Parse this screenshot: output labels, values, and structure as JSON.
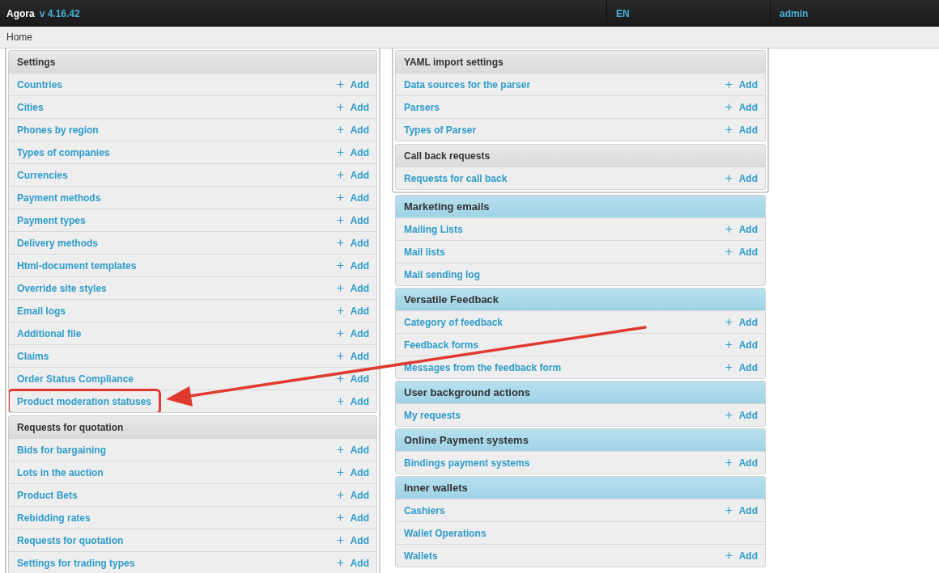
{
  "top_bar": {
    "brand": "Agora",
    "version": "v 4.16.42",
    "language": "EN",
    "user": "admin"
  },
  "breadcrumb": "Home",
  "columns": [
    {
      "blocks": [
        {
          "kind": "framed",
          "sections": [
            {
              "title": "Settings",
              "rows": [
                {
                  "label": "Countries",
                  "action": "Add",
                  "highlighted": false
                },
                {
                  "label": "Cities",
                  "action": "Add",
                  "highlighted": false
                },
                {
                  "label": "Phones by region",
                  "action": "Add",
                  "highlighted": false
                },
                {
                  "label": "Types of companies",
                  "action": "Add",
                  "highlighted": false
                },
                {
                  "label": "Currencies",
                  "action": "Add",
                  "highlighted": false
                },
                {
                  "label": "Payment methods",
                  "action": "Add",
                  "highlighted": false
                },
                {
                  "label": "Payment types",
                  "action": "Add",
                  "highlighted": false
                },
                {
                  "label": "Delivery methods",
                  "action": "Add",
                  "highlighted": false
                },
                {
                  "label": "Html-document templates",
                  "action": "Add",
                  "highlighted": false
                },
                {
                  "label": "Override site styles",
                  "action": "Add",
                  "highlighted": false
                },
                {
                  "label": "Email logs",
                  "action": "Add",
                  "highlighted": false
                },
                {
                  "label": "Additional file",
                  "action": "Add",
                  "highlighted": false
                },
                {
                  "label": "Claims",
                  "action": "Add",
                  "highlighted": false
                },
                {
                  "label": "Order Status Compliance",
                  "action": "Add",
                  "highlighted": false
                },
                {
                  "label": "Product moderation statuses",
                  "action": "Add",
                  "highlighted": true
                }
              ]
            },
            {
              "title": "Requests for quotation",
              "rows": [
                {
                  "label": "Bids for bargaining",
                  "action": "Add"
                },
                {
                  "label": "Lots in the auction",
                  "action": "Add"
                },
                {
                  "label": "Product Bets",
                  "action": "Add"
                },
                {
                  "label": "Rebidding rates",
                  "action": "Add"
                },
                {
                  "label": "Requests for quotation",
                  "action": "Add"
                },
                {
                  "label": "Settings for trading types",
                  "action": "Add"
                }
              ]
            }
          ]
        }
      ]
    },
    {
      "blocks": [
        {
          "kind": "framed",
          "sections": [
            {
              "title": "YAML import settings",
              "rows": [
                {
                  "label": "Data sources for the parser",
                  "action": "Add"
                },
                {
                  "label": "Parsers",
                  "action": "Add"
                },
                {
                  "label": "Types of Parser",
                  "action": "Add"
                }
              ]
            },
            {
              "title": "Call back requests",
              "rows": [
                {
                  "label": "Requests for call back",
                  "action": "Add"
                }
              ]
            }
          ]
        },
        {
          "kind": "panel",
          "sections": [
            {
              "title": "Marketing emails",
              "rows": [
                {
                  "label": "Mailing Lists",
                  "action": "Add"
                },
                {
                  "label": "Mail lists",
                  "action": "Add"
                },
                {
                  "label": "Mail sending log"
                }
              ]
            }
          ]
        },
        {
          "kind": "panel",
          "sections": [
            {
              "title": "Versatile Feedback",
              "rows": [
                {
                  "label": "Category of feedback",
                  "action": "Add"
                },
                {
                  "label": "Feedback forms",
                  "action": "Add"
                },
                {
                  "label": "Messages from the feedback form",
                  "action": "Add"
                }
              ]
            }
          ]
        },
        {
          "kind": "panel",
          "sections": [
            {
              "title": "User background actions",
              "rows": [
                {
                  "label": "My requests",
                  "action": "Add"
                }
              ]
            }
          ]
        },
        {
          "kind": "panel",
          "sections": [
            {
              "title": "Online Payment systems",
              "rows": [
                {
                  "label": "Bindings payment systems",
                  "action": "Add"
                }
              ]
            }
          ]
        },
        {
          "kind": "panel",
          "sections": [
            {
              "title": "Inner wallets",
              "rows": [
                {
                  "label": "Cashiers",
                  "action": "Add"
                },
                {
                  "label": "Wallet Operations"
                },
                {
                  "label": "Wallets",
                  "action": "Add"
                }
              ]
            }
          ]
        }
      ]
    }
  ]
}
